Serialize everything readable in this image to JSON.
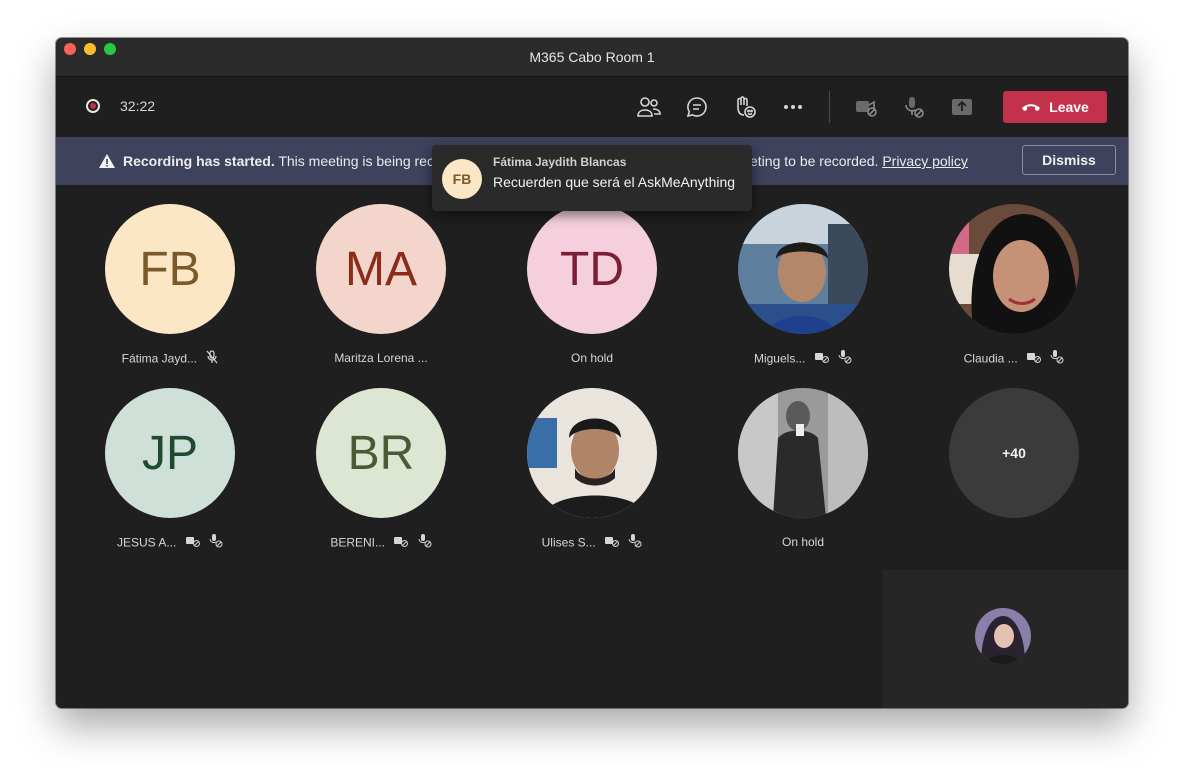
{
  "window": {
    "title": "M365 Cabo Room 1"
  },
  "toolbar": {
    "timer": "32:22",
    "icons": [
      "people-icon",
      "chat-icon",
      "reactions-icon",
      "more-icon",
      "camera-off-icon",
      "mic-off-icon",
      "share-icon"
    ],
    "leave_label": "Leave",
    "leave_color": "#c4314b"
  },
  "banner": {
    "bold": "Recording has started.",
    "text": "This meeting is being rec",
    "rest": "eting to be recorded.",
    "link": "Privacy policy",
    "dismiss_label": "Dismiss"
  },
  "toast": {
    "initials": "FB",
    "sender": "Fátima Jaydith Blancas",
    "message": "Recuerden que será el AskMeAnything"
  },
  "participants": [
    {
      "initials": "FB",
      "name": "Fátima Jayd...",
      "color": "#fbe7c6",
      "text_color": "#7a5a2a"
    },
    {
      "initials": "MA",
      "name": "Maritza Lorena ...",
      "color": "#f4d5cc",
      "text_color": "#8a2c1c"
    },
    {
      "initials": "TD",
      "name": "On hold",
      "color": "#f5d0dc",
      "text_color": "#7a1f36"
    },
    {
      "initials": "",
      "name": "Miguels...",
      "photo": "miguel"
    },
    {
      "initials": "",
      "name": "Claudia ...",
      "photo": "claudia"
    },
    {
      "initials": "JP",
      "name": "JESUS A...",
      "color": "#cfe0d8",
      "text_color": "#1f4a2e"
    },
    {
      "initials": "BR",
      "name": "BERENI...",
      "color": "#dde6d3",
      "text_color": "#4a5a35"
    },
    {
      "initials": "",
      "name": "Ulises S...",
      "photo": "ulises"
    },
    {
      "initials": "",
      "name": "On hold",
      "photo": "onhold"
    },
    {
      "initials": "+40",
      "name": "",
      "color": "#3b3b3b"
    }
  ]
}
